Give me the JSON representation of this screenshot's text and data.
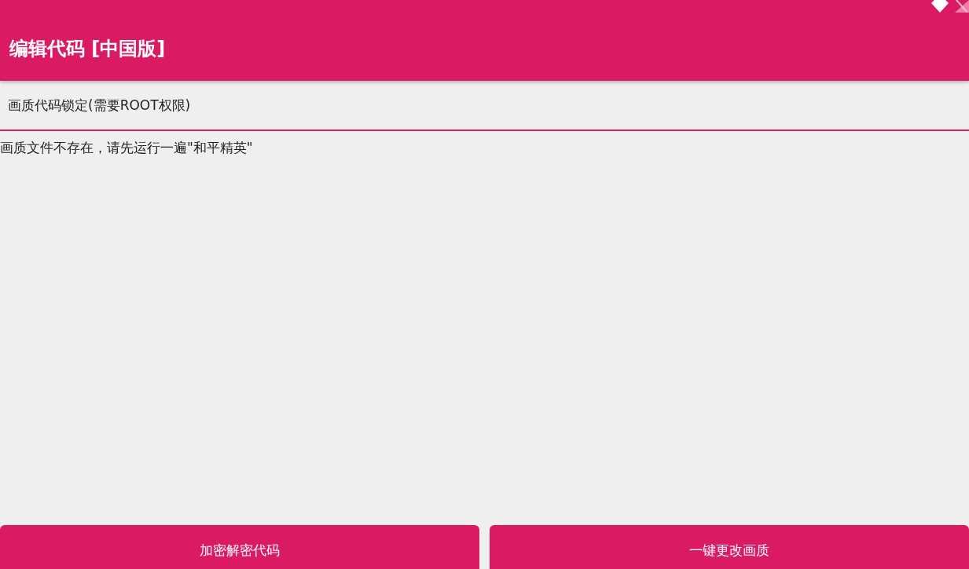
{
  "app_bar": {
    "title": "编辑代码 [中国版]"
  },
  "lock_option": {
    "label": "画质代码锁定(需要ROOT权限)"
  },
  "editor": {
    "value": "画质文件不存在，请先运行一遍\"和平精英\""
  },
  "buttons": [
    {
      "label": "加密解密代码"
    },
    {
      "label": "一键更改画质"
    }
  ]
}
